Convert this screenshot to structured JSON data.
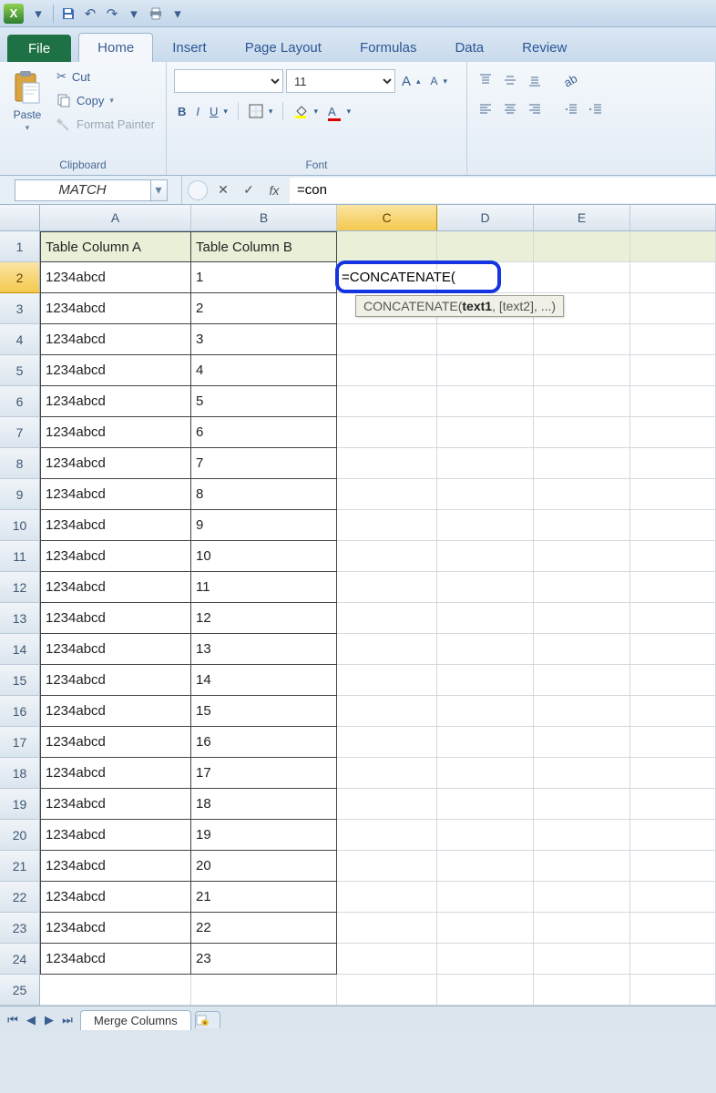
{
  "qat": {
    "logo_letter": "X"
  },
  "tabs": {
    "file": "File",
    "items": [
      "Home",
      "Insert",
      "Page Layout",
      "Formulas",
      "Data",
      "Review"
    ],
    "active": "Home"
  },
  "ribbon": {
    "clipboard": {
      "paste": "Paste",
      "cut": "Cut",
      "copy": "Copy",
      "copy_drop": "▾",
      "format_painter": "Format Painter",
      "group_label": "Clipboard"
    },
    "font": {
      "font_name": "",
      "font_size": "11",
      "bold": "B",
      "italic": "I",
      "underline": "U",
      "group_label": "Font"
    }
  },
  "formula_bar": {
    "name_box": "MATCH",
    "cancel": "✕",
    "enter": "✓",
    "fx": "fx",
    "formula": "=con"
  },
  "grid": {
    "columns": [
      "A",
      "B",
      "C",
      "D",
      "E"
    ],
    "col_widths": [
      "cA",
      "cB",
      "cC",
      "cD",
      "cE",
      "cF"
    ],
    "headers": {
      "A": "Table Column A",
      "B": "Table Column B"
    },
    "rows": [
      {
        "n": 1,
        "A": "Table Column A",
        "B": "Table Column B",
        "hdr": true
      },
      {
        "n": 2,
        "A": "1234abcd",
        "B": "1",
        "active": true
      },
      {
        "n": 3,
        "A": "1234abcd",
        "B": "2"
      },
      {
        "n": 4,
        "A": "1234abcd",
        "B": "3"
      },
      {
        "n": 5,
        "A": "1234abcd",
        "B": "4"
      },
      {
        "n": 6,
        "A": "1234abcd",
        "B": "5"
      },
      {
        "n": 7,
        "A": "1234abcd",
        "B": "6"
      },
      {
        "n": 8,
        "A": "1234abcd",
        "B": "7"
      },
      {
        "n": 9,
        "A": "1234abcd",
        "B": "8"
      },
      {
        "n": 10,
        "A": "1234abcd",
        "B": "9"
      },
      {
        "n": 11,
        "A": "1234abcd",
        "B": "10"
      },
      {
        "n": 12,
        "A": "1234abcd",
        "B": "11"
      },
      {
        "n": 13,
        "A": "1234abcd",
        "B": "12"
      },
      {
        "n": 14,
        "A": "1234abcd",
        "B": "13"
      },
      {
        "n": 15,
        "A": "1234abcd",
        "B": "14"
      },
      {
        "n": 16,
        "A": "1234abcd",
        "B": "15"
      },
      {
        "n": 17,
        "A": "1234abcd",
        "B": "16"
      },
      {
        "n": 18,
        "A": "1234abcd",
        "B": "17"
      },
      {
        "n": 19,
        "A": "1234abcd",
        "B": "18"
      },
      {
        "n": 20,
        "A": "1234abcd",
        "B": "19"
      },
      {
        "n": 21,
        "A": "1234abcd",
        "B": "20"
      },
      {
        "n": 22,
        "A": "1234abcd",
        "B": "21"
      },
      {
        "n": 23,
        "A": "1234abcd",
        "B": "22"
      },
      {
        "n": 24,
        "A": "1234abcd",
        "B": "23"
      },
      {
        "n": 25,
        "A": "",
        "B": ""
      }
    ],
    "active_cell_text": "=CONCATENATE(",
    "tooltip_fn": "CONCATENATE(",
    "tooltip_arg_bold": "text1",
    "tooltip_rest": ", [text2], ...)"
  },
  "sheets": {
    "active": "Merge Columns"
  }
}
